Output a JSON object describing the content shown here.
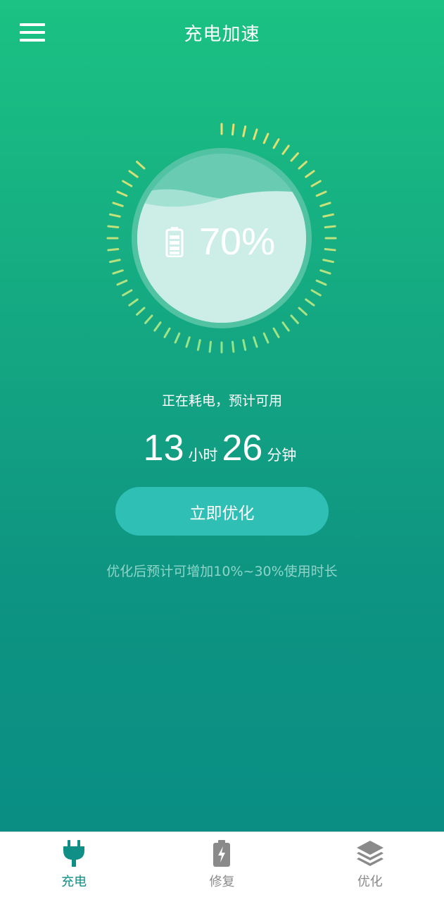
{
  "header": {
    "title": "充电加速",
    "menu_icon": "hamburger-menu-icon"
  },
  "battery": {
    "percent_label": "70%",
    "level": 0.7,
    "icon": "battery-icon",
    "colors": {
      "tick_start": "#f2de6c",
      "tick_end": "#8ee58b",
      "water": "#cdeee7",
      "ring": "#58c4a5"
    }
  },
  "status": {
    "text": "正在耗电，预计可用"
  },
  "remaining": {
    "hours": "13",
    "hours_unit": "小时",
    "minutes": "26",
    "minutes_unit": "分钟"
  },
  "optimize": {
    "button_label": "立即优化",
    "hint": "优化后预计可增加10%~30%使用时长"
  },
  "tabbar": {
    "active_color": "#0f8f85",
    "items": [
      {
        "label": "充电",
        "icon": "plug-icon"
      },
      {
        "label": "修复",
        "icon": "battery-repair-icon"
      },
      {
        "label": "优化",
        "icon": "layers-icon"
      }
    ]
  }
}
